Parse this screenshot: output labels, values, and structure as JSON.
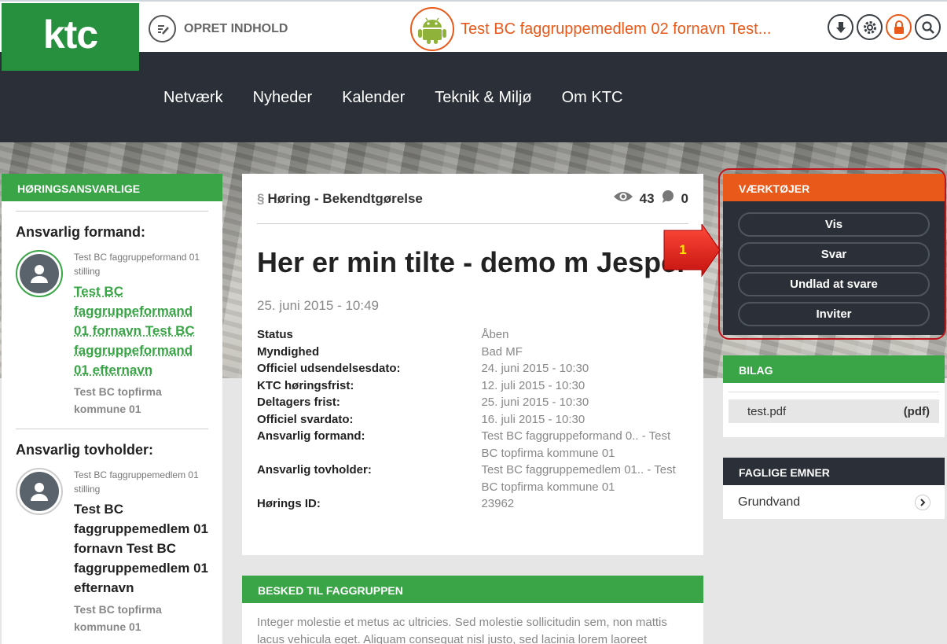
{
  "logo": {
    "text": "ktc"
  },
  "header": {
    "create_label": "OPRET INDHOLD",
    "user_name": "Test BC faggruppemedlem 02 fornavn Test..."
  },
  "nav": {
    "items": [
      "Netværk",
      "Nyheder",
      "Kalender",
      "Teknik & Miljø",
      "Om KTC"
    ]
  },
  "left_panel": {
    "title": "HØRINGSANSVARLIGE",
    "formand": {
      "heading": "Ansvarlig formand:",
      "position": "Test BC faggruppeformand 01 stilling",
      "name": "Test BC faggruppeformand 01 fornavn Test BC faggruppeformand 01 efternavn",
      "company": "Test BC topfirma kommune 01"
    },
    "tovholder": {
      "heading": "Ansvarlig tovholder:",
      "position": "Test BC faggruppemedlem 01 stilling",
      "name": "Test BC faggruppemedlem 01 fornavn Test BC faggruppemedlem 01 efternavn",
      "company": "Test BC topfirma kommune 01"
    }
  },
  "article": {
    "section_symbol": "§",
    "type": "Høring  - Bekendtgørelse",
    "views": "43",
    "comments": "0",
    "title": "Her er min tilte - demo m Jesper",
    "date": "25. juni 2015 - 10:49",
    "meta": [
      {
        "k": "Status",
        "v": "Åben"
      },
      {
        "k": "Myndighed",
        "v": "Bad MF"
      },
      {
        "k": "Officiel udsendelsesdato:",
        "v": "24. juni 2015 - 10:30"
      },
      {
        "k": "KTC høringsfrist:",
        "v": "12. juli 2015 - 10:30"
      },
      {
        "k": "Deltagers frist:",
        "v": "25. juni 2015 - 10:30"
      },
      {
        "k": "Officiel svardato:",
        "v": "16. juli 2015 - 10:30"
      },
      {
        "k": "Ansvarlig formand:",
        "v": "Test BC faggruppeformand 0.. - Test BC topfirma kommune 01"
      },
      {
        "k": "Ansvarlig tovholder:",
        "v": "Test BC faggruppemedlem 01.. - Test BC topfirma kommune 01"
      },
      {
        "k": "Hørings ID:",
        "v": "23962"
      }
    ]
  },
  "besked": {
    "title": "BESKED TIL FAGGRUPPEN",
    "body": "Integer molestie et metus ac ultricies. Sed molestie sollicitudin sem, non mattis lacus vehicula eget. Aliquam consequat nisl justo, sed lacinia lorem laoreet"
  },
  "tools": {
    "title": "VÆRKTØJER",
    "buttons": [
      "Vis",
      "Svar",
      "Undlad at svare",
      "Inviter"
    ],
    "marker": "1"
  },
  "bilag": {
    "title": "BILAG",
    "file_name": "test.pdf",
    "file_type": "(pdf)"
  },
  "faglige": {
    "title": "FAGLIGE EMNER",
    "item": "Grundvand"
  },
  "colors": {
    "green": "#3aa547",
    "orange": "#e8591a",
    "dark": "#2b3038",
    "annotation": "#c0161b"
  }
}
